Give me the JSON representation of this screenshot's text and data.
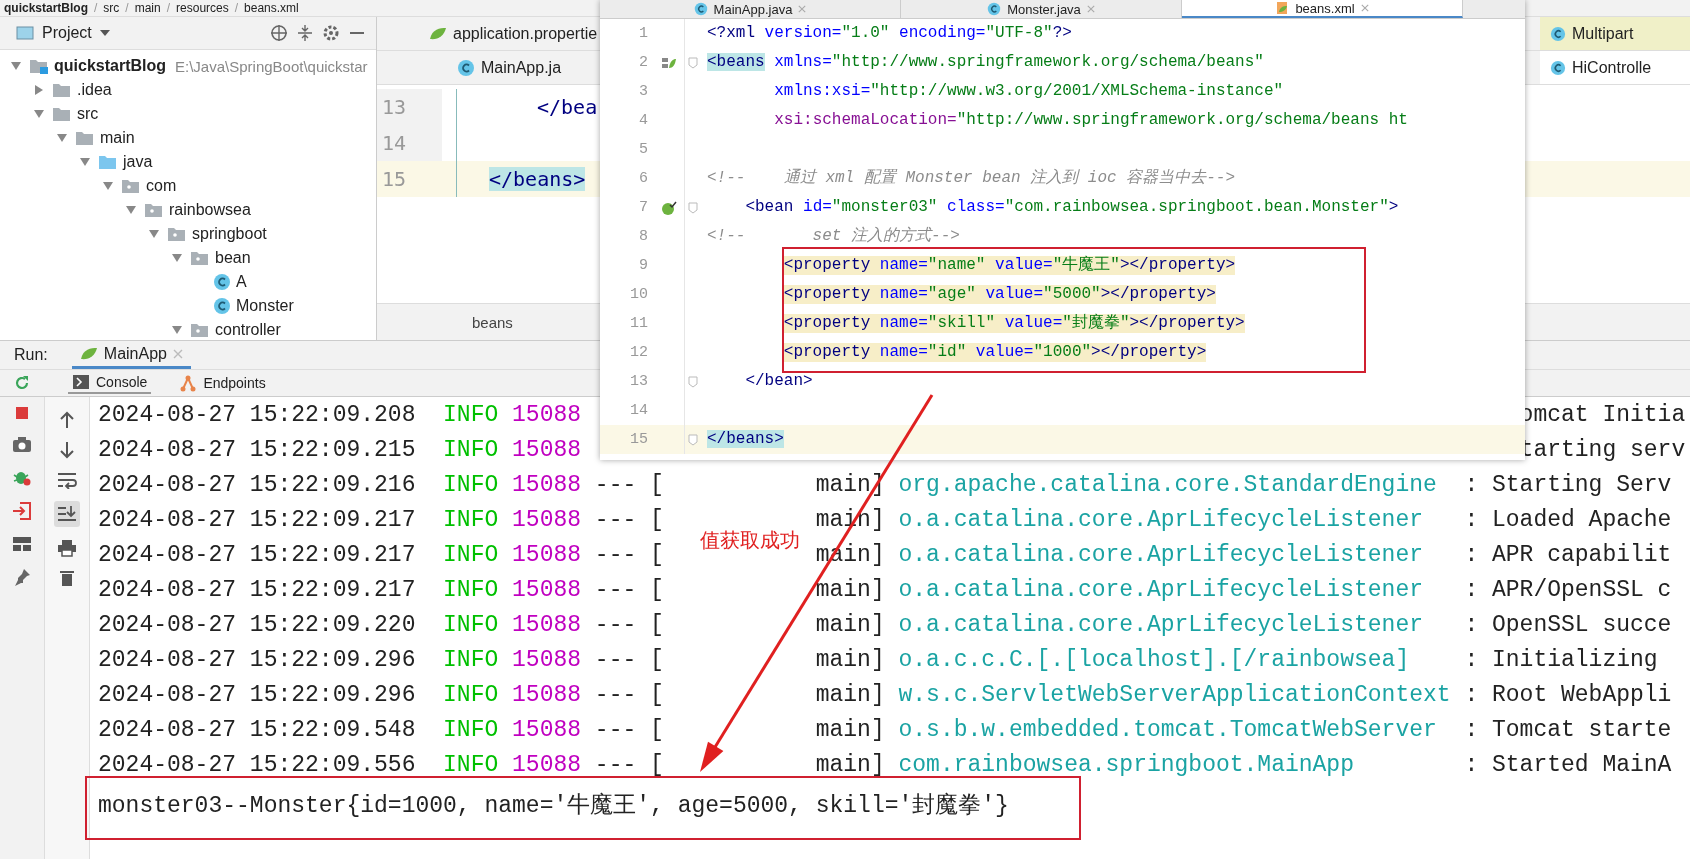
{
  "breadcrumb": {
    "separator": "/",
    "items": [
      "quickstartBlog",
      "src",
      "main",
      "resources",
      "beans.xml"
    ]
  },
  "project_panel": {
    "title": "Project",
    "tree": [
      {
        "label": "quickstartBlog",
        "kind": "module",
        "path": "E:\\Java\\SpringBoot\\quickstar",
        "expanded": true,
        "children": [
          {
            "label": ".idea",
            "kind": "folder",
            "expanded": false
          },
          {
            "label": "src",
            "kind": "folder",
            "expanded": true,
            "children": [
              {
                "label": "main",
                "kind": "folder",
                "expanded": true,
                "children": [
                  {
                    "label": "java",
                    "kind": "source",
                    "expanded": true,
                    "children": [
                      {
                        "label": "com",
                        "kind": "package",
                        "expanded": true,
                        "children": [
                          {
                            "label": "rainbowsea",
                            "kind": "package",
                            "expanded": true,
                            "children": [
                              {
                                "label": "springboot",
                                "kind": "package",
                                "expanded": true,
                                "children": [
                                  {
                                    "label": "bean",
                                    "kind": "package",
                                    "expanded": true,
                                    "children": [
                                      {
                                        "label": "A",
                                        "kind": "class"
                                      },
                                      {
                                        "label": "Monster",
                                        "kind": "class"
                                      }
                                    ]
                                  },
                                  {
                                    "label": "controller",
                                    "kind": "package",
                                    "expanded": true
                                  }
                                ]
                              }
                            ]
                          }
                        ]
                      }
                    ]
                  }
                ]
              }
            ]
          }
        ]
      }
    ]
  },
  "back_editor": {
    "tabs": [
      {
        "label": "application.propertie",
        "kind": "properties"
      },
      {
        "label": "MainApp.ja",
        "kind": "class"
      }
    ],
    "lines": [
      {
        "number": "13",
        "code": "</bea",
        "current": false
      },
      {
        "number": "14",
        "current": false
      },
      {
        "number": "15",
        "code": "</beans>",
        "current": true
      }
    ],
    "footer": "beans"
  },
  "right_editor": {
    "tabs": [
      {
        "label": "Multipart",
        "selected": true
      },
      {
        "label": "HiControlle",
        "selected": false
      }
    ]
  },
  "editor_window": {
    "tabs": [
      {
        "label": "MainApp.java",
        "kind": "class",
        "selected": false
      },
      {
        "label": "Monster.java",
        "kind": "class",
        "selected": false
      },
      {
        "label": "beans.xml",
        "kind": "xml",
        "selected": true
      }
    ],
    "lines": [
      {
        "number": "1",
        "kind": "plain",
        "fold": false,
        "highlighted": false,
        "current": false,
        "segments": [
          {
            "text": "<?xml ",
            "kind": "tag"
          },
          {
            "text": "version=",
            "kind": "attr"
          },
          {
            "text": "\"1.0\"",
            "kind": "value"
          },
          {
            "text": " encoding=",
            "kind": "attr"
          },
          {
            "text": "\"UTF-8\"",
            "kind": "value"
          },
          {
            "text": "?>",
            "kind": "tag"
          }
        ]
      },
      {
        "number": "2",
        "kind": "bean",
        "fold": true,
        "highlighted": false,
        "current": false,
        "segments": [
          {
            "text": "<beans",
            "kind": "tag-match"
          },
          {
            "text": " xmlns=",
            "kind": "attr"
          },
          {
            "text": "\"http://www.springframework.org/schema/beans\"",
            "kind": "value"
          }
        ]
      },
      {
        "number": "3",
        "kind": "plain",
        "fold": false,
        "highlighted": false,
        "current": false,
        "segments": [
          {
            "text": "       xmlns:xsi=",
            "kind": "attr"
          },
          {
            "text": "\"http://www.w3.org/2001/XMLSchema-instance\"",
            "kind": "value"
          }
        ]
      },
      {
        "number": "4",
        "kind": "plain",
        "fold": false,
        "highlighted": false,
        "current": false,
        "segments": [
          {
            "text": "       xsi:schemaLocation=",
            "kind": "ns"
          },
          {
            "text": "\"http://www.springframework.org/schema/beans ht",
            "kind": "value"
          }
        ]
      },
      {
        "number": "5",
        "kind": "plain",
        "fold": false,
        "highlighted": false,
        "current": false
      },
      {
        "number": "6",
        "kind": "plain",
        "fold": false,
        "highlighted": false,
        "current": false,
        "segments": [
          {
            "text": "<!--    通过 xml 配置 Monster bean 注入到 ioc 容器当中去-->",
            "kind": "comment"
          }
        ]
      },
      {
        "number": "7",
        "kind": "bean-check",
        "fold": true,
        "highlighted": false,
        "current": false,
        "segments": [
          {
            "text": "    <bean",
            "kind": "tag"
          },
          {
            "text": " id=",
            "kind": "attr"
          },
          {
            "text": "\"monster03\"",
            "kind": "value"
          },
          {
            "text": " class=",
            "kind": "attr"
          },
          {
            "text": "\"com.rainbowsea.springboot.bean.Monster\"",
            "kind": "value"
          },
          {
            "text": ">",
            "kind": "tag"
          }
        ]
      },
      {
        "number": "8",
        "kind": "plain",
        "fold": false,
        "highlighted": false,
        "current": false,
        "segments": [
          {
            "text": "<!--       set 注入的方式-->",
            "kind": "comment"
          }
        ]
      },
      {
        "number": "9",
        "kind": "plain",
        "fold": false,
        "highlighted": true,
        "current": false,
        "segments": [
          {
            "text": "        <property",
            "kind": "tag"
          },
          {
            "text": " name=",
            "kind": "attr"
          },
          {
            "text": "\"name\"",
            "kind": "value"
          },
          {
            "text": " value=",
            "kind": "attr"
          },
          {
            "text": "\"牛魔王\"",
            "kind": "value"
          },
          {
            "text": "></property>",
            "kind": "tag"
          }
        ]
      },
      {
        "number": "10",
        "kind": "plain",
        "fold": false,
        "highlighted": true,
        "current": false,
        "segments": [
          {
            "text": "        <property",
            "kind": "tag"
          },
          {
            "text": " name=",
            "kind": "attr"
          },
          {
            "text": "\"age\"",
            "kind": "value"
          },
          {
            "text": " value=",
            "kind": "attr"
          },
          {
            "text": "\"5000\"",
            "kind": "value"
          },
          {
            "text": "></property>",
            "kind": "tag"
          }
        ]
      },
      {
        "number": "11",
        "kind": "plain",
        "fold": false,
        "highlighted": true,
        "current": false,
        "segments": [
          {
            "text": "        <property",
            "kind": "tag"
          },
          {
            "text": " name=",
            "kind": "attr"
          },
          {
            "text": "\"skill\"",
            "kind": "value"
          },
          {
            "text": " value=",
            "kind": "attr"
          },
          {
            "text": "\"封魔拳\"",
            "kind": "value"
          },
          {
            "text": "></property>",
            "kind": "tag"
          }
        ]
      },
      {
        "number": "12",
        "kind": "plain",
        "fold": false,
        "highlighted": true,
        "current": false,
        "segments": [
          {
            "text": "        <property",
            "kind": "tag"
          },
          {
            "text": " name=",
            "kind": "attr"
          },
          {
            "text": "\"id\"",
            "kind": "value"
          },
          {
            "text": " value=",
            "kind": "attr"
          },
          {
            "text": "\"1000\"",
            "kind": "value"
          },
          {
            "text": "></property>",
            "kind": "tag"
          }
        ]
      },
      {
        "number": "13",
        "kind": "plain",
        "fold": true,
        "highlighted": false,
        "current": false,
        "segments": [
          {
            "text": "    </bean>",
            "kind": "tag"
          }
        ]
      },
      {
        "number": "14",
        "kind": "plain",
        "fold": false,
        "highlighted": false,
        "current": false
      },
      {
        "number": "15",
        "kind": "plain",
        "fold": true,
        "highlighted": false,
        "current": true,
        "segments": [
          {
            "text": "</beans>",
            "kind": "tag-match"
          }
        ]
      }
    ]
  },
  "run_panel": {
    "label": "Run:",
    "config": "MainApp",
    "tabs": [
      {
        "label": "Console",
        "kind": "console",
        "selected": true
      },
      {
        "label": "Endpoints",
        "kind": "endpoints",
        "selected": false
      }
    ],
    "log": [
      {
        "kind": "partial",
        "time": "2024-08-27 15:22:09.208",
        "level": "INFO",
        "pid": "15088",
        "message": "omcat Initia"
      },
      {
        "kind": "partial",
        "time": "2024-08-27 15:22:09.215",
        "level": "INFO",
        "pid": "15088",
        "message": "tarting serv"
      },
      {
        "kind": "full",
        "time": "2024-08-27 15:22:09.216",
        "level": "INFO",
        "pid": "15088",
        "sep": "---",
        "bracket": "[",
        "thread": "main]",
        "logger": "org.apache.catalina.core.StandardEngine",
        "colon": ":",
        "message": "Starting Serv"
      },
      {
        "kind": "full",
        "time": "2024-08-27 15:22:09.217",
        "level": "INFO",
        "pid": "15088",
        "sep": "---",
        "bracket": "[",
        "thread": "main]",
        "logger": "o.a.catalina.core.AprLifecycleListener",
        "colon": ":",
        "message": "Loaded Apache"
      },
      {
        "kind": "full",
        "time": "2024-08-27 15:22:09.217",
        "level": "INFO",
        "pid": "15088",
        "sep": "---",
        "bracket": "[",
        "thread": "main]",
        "logger": "o.a.catalina.core.AprLifecycleListener",
        "colon": ":",
        "message": "APR capabilit"
      },
      {
        "kind": "full",
        "time": "2024-08-27 15:22:09.217",
        "level": "INFO",
        "pid": "15088",
        "sep": "---",
        "bracket": "[",
        "thread": "main]",
        "logger": "o.a.catalina.core.AprLifecycleListener",
        "colon": ":",
        "message": "APR/OpenSSL c"
      },
      {
        "kind": "full",
        "time": "2024-08-27 15:22:09.220",
        "level": "INFO",
        "pid": "15088",
        "sep": "---",
        "bracket": "[",
        "thread": "main]",
        "logger": "o.a.catalina.core.AprLifecycleListener",
        "colon": ":",
        "message": "OpenSSL succe"
      },
      {
        "kind": "full",
        "time": "2024-08-27 15:22:09.296",
        "level": "INFO",
        "pid": "15088",
        "sep": "---",
        "bracket": "[",
        "thread": "main]",
        "logger": "o.a.c.c.C.[.[localhost].[/rainbowsea]",
        "colon": ":",
        "message": "Initializing"
      },
      {
        "kind": "full",
        "time": "2024-08-27 15:22:09.296",
        "level": "INFO",
        "pid": "15088",
        "sep": "---",
        "bracket": "[",
        "thread": "main]",
        "logger": "w.s.c.ServletWebServerApplicationContext",
        "colon": ":",
        "message": "Root WebAppli"
      },
      {
        "kind": "full",
        "time": "2024-08-27 15:22:09.548",
        "level": "INFO",
        "pid": "15088",
        "sep": "---",
        "bracket": "[",
        "thread": "main]",
        "logger": "o.s.b.w.embedded.tomcat.TomcatWebServer",
        "colon": ":",
        "message": "Tomcat starte"
      },
      {
        "kind": "full",
        "time": "2024-08-27 15:22:09.556",
        "level": "INFO",
        "pid": "15088",
        "sep": "---",
        "bracket": "[",
        "thread": "main]",
        "logger": "com.rainbowsea.springboot.MainApp",
        "colon": ":",
        "message": "Started MainA"
      }
    ],
    "output": "monster03--Monster{id=1000, name='牛魔王', age=5000, skill='封魔拳'}"
  },
  "annotation": {
    "note": "值获取成功"
  }
}
